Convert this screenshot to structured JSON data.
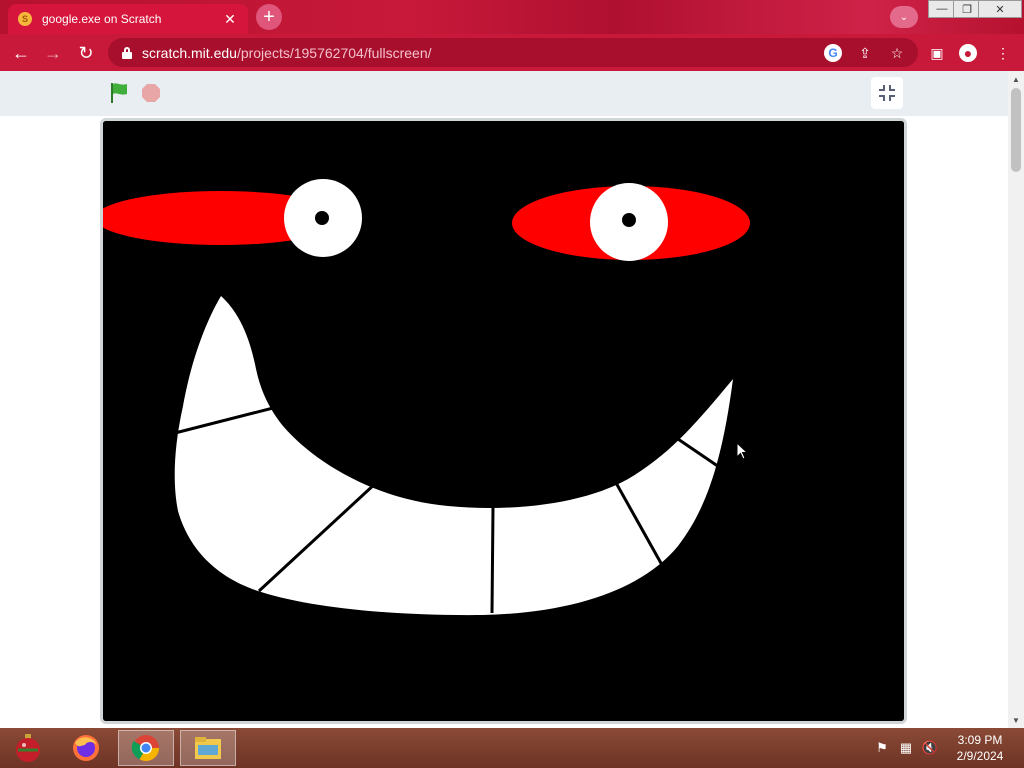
{
  "browser": {
    "tab": {
      "title": "google.exe on Scratch",
      "close_glyph": "✕",
      "favicon_icon": "scratch-favicon"
    },
    "new_tab_glyph": "+",
    "window_buttons": {
      "minimize": "—",
      "restore": "❐",
      "close": "✕"
    },
    "address": {
      "host": "scratch.mit.edu",
      "path": "/projects/195762704/fullscreen/"
    },
    "nav": {
      "back": "←",
      "forward": "→",
      "reload": "↻"
    },
    "icons": [
      "google-lens-icon",
      "share-icon",
      "bookmark-star-icon",
      "side-panel-icon",
      "profile-icon",
      "menu-icon"
    ]
  },
  "scratch": {
    "green_flag_color": "#3fae3a",
    "stop_color": "#e9a6a6",
    "stage_background": "#000000",
    "eye_color": "#ff0000",
    "teeth_color": "#ffffff"
  },
  "taskbar": {
    "apps": [
      "christmas-ornament-icon",
      "firefox-icon",
      "chrome-icon",
      "file-explorer-icon"
    ],
    "tray": [
      "flag-icon",
      "network-icon",
      "volume-muted-icon"
    ],
    "time": "3:09 PM",
    "date": "2/9/2024"
  }
}
